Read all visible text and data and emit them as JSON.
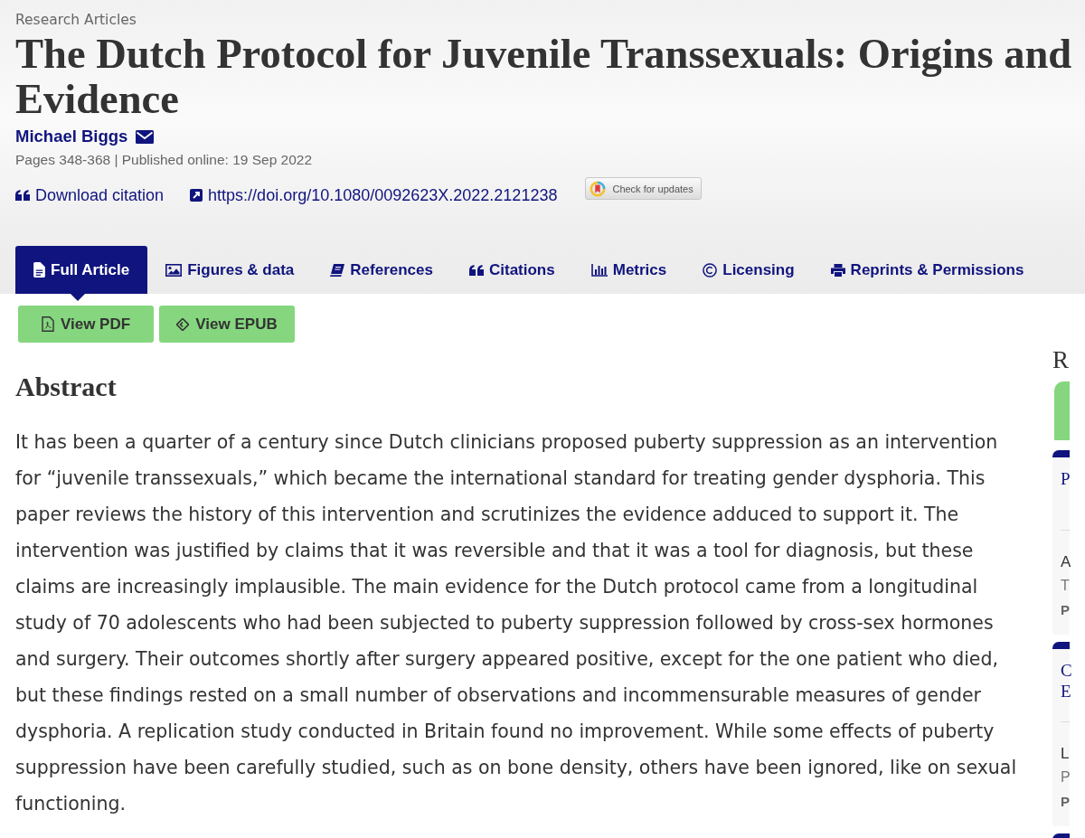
{
  "header": {
    "section": "Research Articles",
    "title": "The Dutch Protocol for Juvenile Transsexuals: Origins and Evidence",
    "author": "Michael Biggs",
    "publication_info": "Pages 348-368 | Published online: 19 Sep 2022",
    "download_citation": "Download citation",
    "doi_link": "https://doi.org/10.1080/0092623X.2022.2121238",
    "updates_badge": "Check for updates"
  },
  "tabs": [
    {
      "label": "Full Article",
      "selected": true
    },
    {
      "label": "Figures & data",
      "selected": false
    },
    {
      "label": "References",
      "selected": false
    },
    {
      "label": "Citations",
      "selected": false
    },
    {
      "label": "Metrics",
      "selected": false
    },
    {
      "label": "Licensing",
      "selected": false
    },
    {
      "label": "Reprints & Permissions",
      "selected": false
    }
  ],
  "buttons": [
    {
      "label": "View PDF"
    },
    {
      "label": "View EPUB"
    }
  ],
  "abstract": {
    "heading": "Abstract",
    "text": "It has been a quarter of a century since Dutch clinicians proposed puberty suppression as an intervention for “juvenile transsexuals,” which became the international standard for treating gender dysphoria. This paper reviews the history of this intervention and scrutinizes the evidence adduced to support it. The intervention was justified by claims that it was reversible and that it was a tool for diagnosis, but these claims are increasingly implausible. The main evidence for the Dutch protocol came from a longitudinal study of 70 adolescents who had been subjected to puberty suppression followed by cross-sex hormones and surgery. Their outcomes shortly after surgery appeared positive, except for the one patient who died, but these findings rested on a small number of observations and incommensurable measures of gender dysphoria. A replication study conducted in Britain found no improvement. While some effects of puberty suppression have been carefully studied, such as on bone density, others have been ignored, like on sexual functioning."
  },
  "sidebar": {
    "heading": "R",
    "cards": [
      {
        "kind": "article",
        "title": "P",
        "author": "A",
        "source": "T",
        "published": "P"
      },
      {
        "kind": "article",
        "title": "C E",
        "author": "L",
        "source": "P",
        "published": "P"
      },
      {
        "kind": "edge"
      }
    ]
  }
}
